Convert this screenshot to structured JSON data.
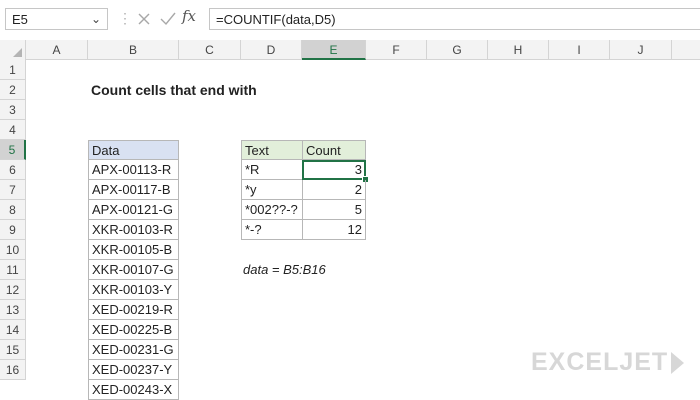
{
  "formula_bar": {
    "name_box": "E5",
    "name_box_arrow": "⌄",
    "separator": "⋮",
    "fx_label": "fx",
    "formula": "=COUNTIF(data,D5)"
  },
  "columns": [
    "A",
    "B",
    "C",
    "D",
    "E",
    "F",
    "G",
    "H",
    "I",
    "J"
  ],
  "rows": [
    "1",
    "2",
    "3",
    "4",
    "5",
    "6",
    "7",
    "8",
    "9",
    "10",
    "11",
    "12",
    "13",
    "14",
    "15",
    "16"
  ],
  "active_cell": {
    "column": "E",
    "row": "5"
  },
  "sheet": {
    "title": "Count cells that end with",
    "data_header": "Data",
    "data_values": [
      "APX-00113-R",
      "APX-00117-B",
      "APX-00121-G",
      "XKR-00103-R",
      "XKR-00105-B",
      "XKR-00107-G",
      "XKR-00103-Y",
      "XED-00219-R",
      "XED-00225-B",
      "XED-00231-G",
      "XED-00237-Y",
      "XED-00243-X"
    ],
    "summary_headers": {
      "text": "Text",
      "count": "Count"
    },
    "summary_rows": [
      {
        "text": "*R",
        "count": "3"
      },
      {
        "text": "*y",
        "count": "2"
      },
      {
        "text": "*002??-?",
        "count": "5"
      },
      {
        "text": "*-?",
        "count": "12"
      }
    ],
    "named_range_note": "data = B5:B16"
  },
  "watermark": "EXCELJET",
  "colors": {
    "accent_green": "#217346",
    "data_header_bg": "#d9e1f2",
    "summary_header_bg": "#e2efda",
    "grid_line": "#d4d4d4"
  },
  "icons": {
    "cancel": "x-icon",
    "enter": "check-icon",
    "function": "fx-icon"
  }
}
